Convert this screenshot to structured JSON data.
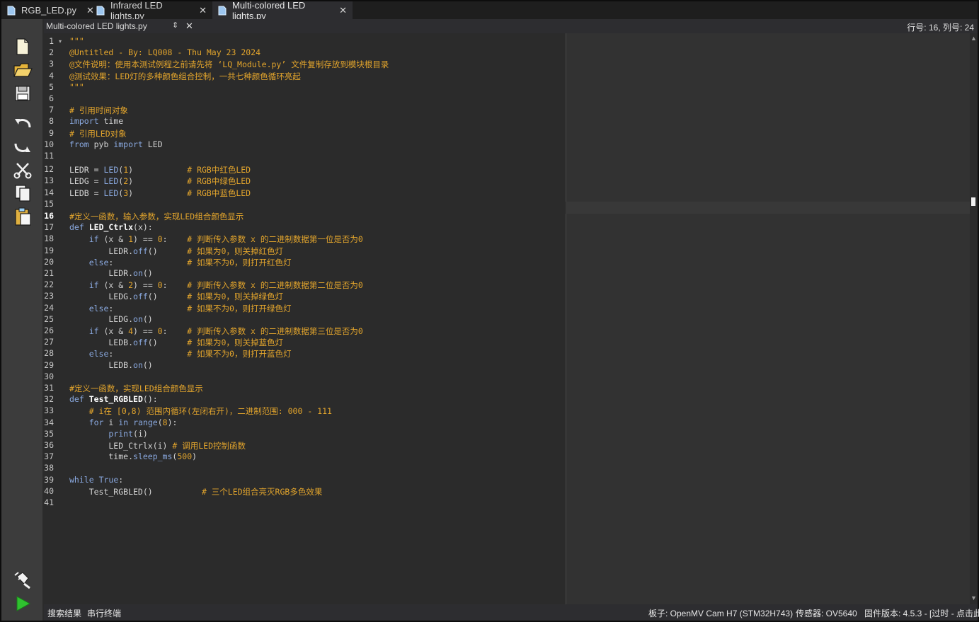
{
  "tabs": [
    {
      "label": "RGB_LED.py"
    },
    {
      "label": "Infrared LED lights.py"
    },
    {
      "label": "Multi-colored LED lights.py"
    }
  ],
  "file_header": {
    "filename": "Multi-colored LED lights.py",
    "cursor_position": "行号: 16, 列号: 24"
  },
  "toolbar_icons": [
    "new-file-icon",
    "open-folder-icon",
    "save-icon",
    "undo-icon",
    "redo-icon",
    "cut-icon",
    "copy-icon",
    "paste-icon",
    "connect-icon",
    "run-icon"
  ],
  "code_lines": [
    "1",
    "2",
    "3",
    "4",
    "5",
    "6",
    "7",
    "8",
    "9",
    "10",
    "11",
    "12",
    "13",
    "14",
    "15",
    "16",
    "17",
    "18",
    "19",
    "20",
    "21",
    "22",
    "23",
    "24",
    "25",
    "26",
    "27",
    "28",
    "29",
    "30",
    "31",
    "32",
    "33",
    "34",
    "35",
    "36",
    "37",
    "38",
    "39",
    "40",
    "41"
  ],
  "code": [
    "\"\"\"",
    "@Untitled - By: LQ008 - Thu May 23 2024",
    "@文件说明：使用本测试例程之前请先将 ‘LQ_Module.py’ 文件复制存放到模块根目录",
    "@测试效果：LED灯的多种颜色组合控制，一共七种颜色循环亮起",
    "\"\"\"",
    "",
    "# 引用时间对象",
    "import time",
    "# 引用LED对象",
    "from pyb import LED",
    "",
    "LEDR = LED(1)",
    "LEDG = LED(2)",
    "LEDB = LED(3)",
    "",
    "#定义一函数，输入参数，实现LED组合颜色显示",
    "def LED_Ctrlx(x):",
    "if (x & 1) == 0:",
    "LEDR.off()",
    "else:",
    "LEDR.on()",
    "if (x & 2) == 0:",
    "LEDG.off()",
    "else:",
    "LEDG.on()",
    "if (x & 4) == 0:",
    "LEDB.off()",
    "else:",
    "LEDB.on()",
    "",
    "#定义一函数，实现LED组合颜色显示",
    "def Test_RGBLED():",
    "# i在 [0,8) 范围内循环(左闭右开)，二进制范围: 000 - 111",
    "for i in range(8):",
    "print(i)",
    "LED_Ctrlx(i)",
    "time.sleep_ms(500)",
    "",
    "while True:",
    "Test_RGBLED()",
    ""
  ],
  "comments": {
    "12": "# RGB中红色LED",
    "13": "# RGB中绿色LED",
    "14": "# RGB中蓝色LED",
    "18": "# 判断传入参数 x 的二进制数据第一位是否为0",
    "19": "# 如果为0，则关掉红色灯",
    "20": "# 如果不为0，则打开红色灯",
    "22": "# 判断传入参数 x 的二进制数据第二位是否为0",
    "23": "# 如果为0，则关掉绿色灯",
    "24": "# 如果不为0，则打开绿色灯",
    "26": "# 判断传入参数 x 的二进制数据第三位是否为0",
    "27": "# 如果为0，则关掉蓝色灯",
    "28": "# 如果不为0，则打开蓝色灯",
    "36": "# 调用LED控制函数",
    "40": "# 三个LED组合亮灭RGB多色效果"
  },
  "current_line": "16",
  "status": {
    "search_results": "搜索结果",
    "serial_terminal": "串行终端",
    "board": "板子: OpenMV Cam H7 (STM32H743)",
    "sensor": "传感器: OV5640",
    "firmware": "固件版本: 4.5.3 - [过时 - 点击此"
  },
  "colors": {
    "keyword": "#8aa9e0",
    "comment": "#e3a52c",
    "background": "#2b2b2b",
    "toolbar": "#3c3c3c"
  }
}
